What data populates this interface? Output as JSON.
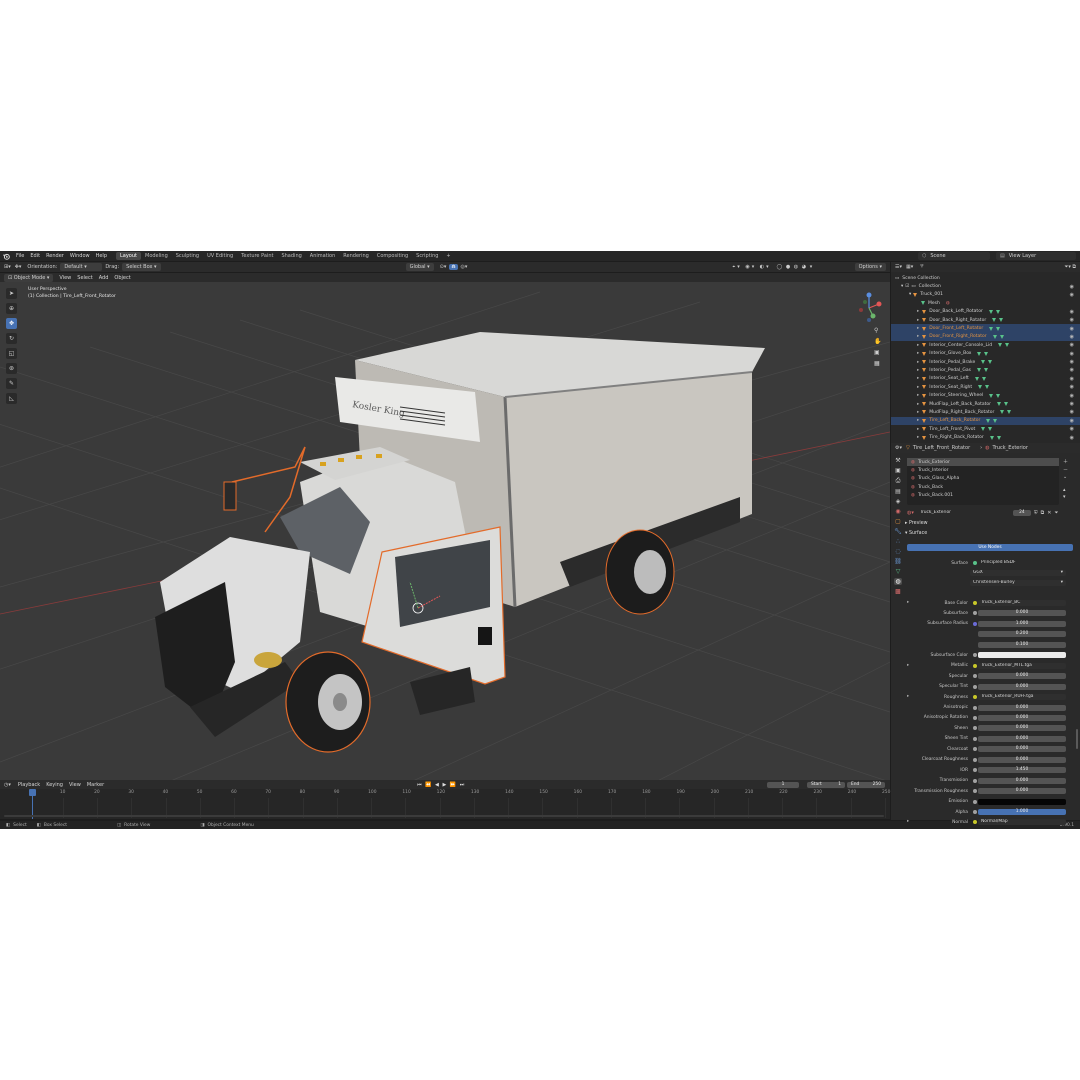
{
  "topbar": {
    "menus": [
      "File",
      "Edit",
      "Render",
      "Window",
      "Help"
    ],
    "workspaces": [
      "Layout",
      "Modeling",
      "Sculpting",
      "UV Editing",
      "Texture Paint",
      "Shading",
      "Animation",
      "Rendering",
      "Compositing",
      "Scripting"
    ],
    "active_workspace": "Layout",
    "add_workspace": "+",
    "scene": "Scene",
    "view_layer": "View Layer"
  },
  "viewport_header": {
    "orientation_label": "Orientation:",
    "orientation_value": "Default",
    "drag_label": "Drag:",
    "drag_value": "Select Box",
    "transform_space": "Global",
    "options": "Options"
  },
  "viewport_menu": {
    "mode": "Object Mode",
    "items": [
      "View",
      "Select",
      "Add",
      "Object"
    ]
  },
  "viewport_info": {
    "line1": "User Perspective",
    "line2": "(1) Collection | Tire_Left_Front_Rotator"
  },
  "truck": {
    "brand": "Kosler King"
  },
  "outliner": {
    "title": "Scene Collection",
    "collection": "Collection",
    "root": "Truck_001",
    "mesh": "Mesh",
    "items": [
      {
        "name": "Door_Back_Left_Rotator",
        "sel": false
      },
      {
        "name": "Door_Back_Right_Rotator",
        "sel": false
      },
      {
        "name": "Door_Front_Left_Rotator",
        "sel": true
      },
      {
        "name": "Door_Front_Right_Rotator",
        "sel": true
      },
      {
        "name": "Interior_Center_Console_Lid",
        "sel": false
      },
      {
        "name": "Interior_Glove_Box",
        "sel": false
      },
      {
        "name": "Interior_Pedal_Brake",
        "sel": false
      },
      {
        "name": "Interior_Pedal_Gas",
        "sel": false
      },
      {
        "name": "Interior_Seat_Left",
        "sel": false
      },
      {
        "name": "Interior_Seat_Right",
        "sel": false
      },
      {
        "name": "Interior_Steering_Wheel",
        "sel": false
      },
      {
        "name": "MudFlap_Left_Back_Rotator",
        "sel": false
      },
      {
        "name": "MudFlap_Right_Back_Rotator",
        "sel": false
      },
      {
        "name": "Tire_Left_Back_Rotator",
        "sel": true
      },
      {
        "name": "Tire_Left_Front_Pivot",
        "sel": false
      },
      {
        "name": "Tire_Right_Back_Rotator",
        "sel": false
      }
    ]
  },
  "properties": {
    "object_name": "Tire_Left_Front_Rotator",
    "material_name": "Truck_Exterior",
    "slots": [
      "Truck_Exterior",
      "Truck_Interior",
      "Truck_Glass_Alpha",
      "Truck_Back",
      "Truck_Back.001"
    ],
    "active_slot": "Truck_Exterior",
    "user_count": "24",
    "preview": "Preview",
    "surface": "Surface",
    "use_nodes": "Use Nodes",
    "surface_label": "Surface",
    "surface_value": "Principled BSDF",
    "distribution": "GGX",
    "subsurface_method": "Christensen-Burley",
    "rows": [
      {
        "label": "Base Color",
        "value": "Truck_Exterior_BC",
        "kind": "text"
      },
      {
        "label": "Subsurface",
        "value": "0.000",
        "kind": "num"
      },
      {
        "label": "Subsurface Radius",
        "value": "1.000",
        "kind": "num"
      },
      {
        "label": "",
        "value": "0.200",
        "kind": "num"
      },
      {
        "label": "",
        "value": "0.100",
        "kind": "num"
      },
      {
        "label": "Subsurface Color",
        "value": "",
        "kind": "white"
      },
      {
        "label": "Metallic",
        "value": "Truck_Exterior_MTL.tga",
        "kind": "text"
      },
      {
        "label": "Specular",
        "value": "0.000",
        "kind": "num"
      },
      {
        "label": "Specular Tint",
        "value": "0.000",
        "kind": "num"
      },
      {
        "label": "Roughness",
        "value": "Truck_Exterior_RUFF.tga",
        "kind": "text"
      },
      {
        "label": "Anisotropic",
        "value": "0.000",
        "kind": "num"
      },
      {
        "label": "Anisotropic Rotation",
        "value": "0.000",
        "kind": "num"
      },
      {
        "label": "Sheen",
        "value": "0.000",
        "kind": "num"
      },
      {
        "label": "Sheen Tint",
        "value": "0.000",
        "kind": "num"
      },
      {
        "label": "Clearcoat",
        "value": "0.000",
        "kind": "num"
      },
      {
        "label": "Clearcoat Roughness",
        "value": "0.000",
        "kind": "num"
      },
      {
        "label": "IOR",
        "value": "1.450",
        "kind": "num"
      },
      {
        "label": "Transmission",
        "value": "0.000",
        "kind": "num"
      },
      {
        "label": "Transmission Roughness",
        "value": "0.000",
        "kind": "num"
      },
      {
        "label": "Emission",
        "value": "",
        "kind": "black"
      },
      {
        "label": "Alpha",
        "value": "1.000",
        "kind": "blue"
      },
      {
        "label": "Normal",
        "value": "Normal/Map",
        "kind": "text"
      }
    ]
  },
  "timeline": {
    "menus": [
      "Playback",
      "Keying",
      "View",
      "Marker"
    ],
    "current_frame": "1",
    "start_label": "Start",
    "start": "1",
    "end_label": "End",
    "end": "250",
    "frames": [
      "1",
      "10",
      "20",
      "30",
      "40",
      "50",
      "60",
      "70",
      "80",
      "90",
      "100",
      "110",
      "120",
      "130",
      "140",
      "150",
      "160",
      "170",
      "180",
      "190",
      "200",
      "210",
      "220",
      "230",
      "240",
      "250"
    ]
  },
  "statusbar": {
    "select": "Select",
    "box_select": "Box Select",
    "rotate_view": "Rotate View",
    "context_menu": "Object Context Menu",
    "version": "2.90.1"
  },
  "colors": {
    "accent_blue": "#4772b3",
    "selection_orange": "#f08c3c",
    "grid": "#444444",
    "viewport_bg": "#3a3a3a"
  }
}
